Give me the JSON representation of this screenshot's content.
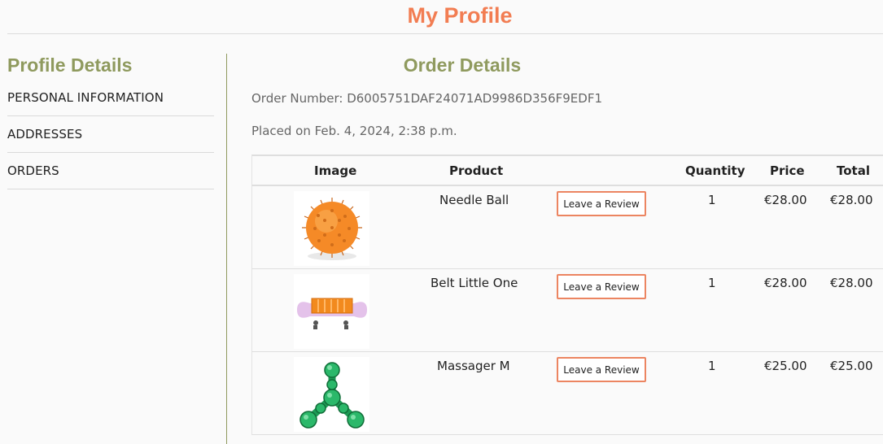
{
  "page": {
    "title": "My Profile"
  },
  "sidebar": {
    "heading": "Profile Details",
    "items": [
      {
        "label": "PERSONAL INFORMATION"
      },
      {
        "label": "ADDRESSES"
      },
      {
        "label": "ORDERS"
      }
    ]
  },
  "order": {
    "heading": "Order Details",
    "number_text": "Order Number: D6005751DAF24071AD9986D356F9EDF1",
    "placed_text": "Placed on Feb. 4, 2024, 2:38 p.m.",
    "columns": {
      "image": "Image",
      "product": "Product",
      "quantity": "Quantity",
      "price": "Price",
      "total": "Total"
    },
    "review_label": "Leave a Review",
    "items": [
      {
        "product": "Needle Ball",
        "quantity": "1",
        "price": "€28.00",
        "total": "€28.00",
        "image_icon": "needle-ball-image"
      },
      {
        "product": "Belt Little One",
        "quantity": "1",
        "price": "€28.00",
        "total": "€28.00",
        "image_icon": "belt-image"
      },
      {
        "product": "Massager M",
        "quantity": "1",
        "price": "€25.00",
        "total": "€25.00",
        "image_icon": "massager-image"
      }
    ]
  },
  "colors": {
    "accent": "#f27d52",
    "heading": "#8f9a5e",
    "border": "#ec8561"
  }
}
